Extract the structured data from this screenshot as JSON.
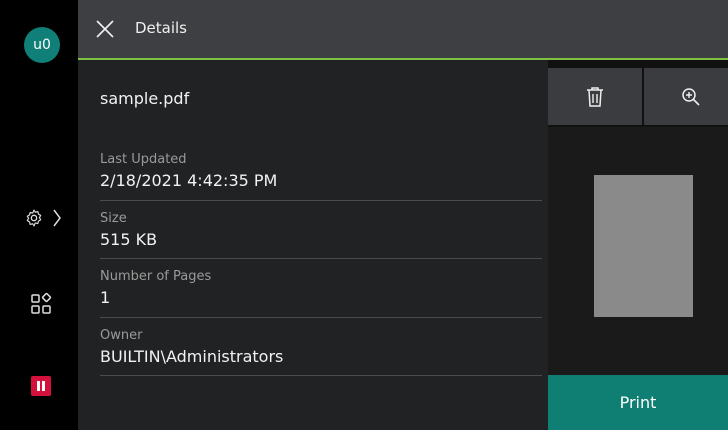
{
  "user": {
    "avatar_label": "u0"
  },
  "header": {
    "title": "Details"
  },
  "file": {
    "name": "sample.pdf",
    "properties": [
      {
        "label": "Last Updated",
        "value": "2/18/2021 4:42:35 PM"
      },
      {
        "label": "Size",
        "value": "515 KB"
      },
      {
        "label": "Number of Pages",
        "value": "1"
      },
      {
        "label": "Owner",
        "value": "BUILTIN\\Administrators"
      }
    ]
  },
  "actions": {
    "print_label": "Print"
  },
  "icons": {
    "close": "close-icon",
    "settings": "gear-icon",
    "apps": "apps-icon",
    "pause": "pause-icon",
    "delete": "trash-icon",
    "zoom": "zoom-in-icon"
  },
  "colors": {
    "accent": "#0f7f74",
    "avatar": "#0f7f78",
    "header_line": "#7fc241",
    "pause": "#d4103c"
  }
}
